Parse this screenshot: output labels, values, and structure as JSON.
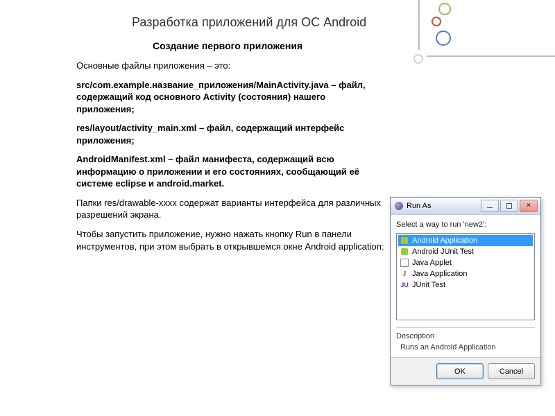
{
  "title": "Разработка приложений для ОС Android",
  "subtitle": "Создание первого приложения",
  "paragraphs": {
    "p1": "Основные файлы приложения – это:",
    "p2": "src/com.example.название_приложения/MainActivity.java – файл, содержащий код основного Activity (состояния) нашего приложения;",
    "p3": "res/layout/activity_main.xml – файл, содержащий интерфейс приложения;",
    "p4": "AndroidManifest.xml – файл манифеста, содержащий всю информацию о приложении и его состояниях, сообщающий её системе eclipse и android.market.",
    "p5": "Папки res/drawable-xxxx содержат варианты интерфейса для различных разрешений экрана.",
    "p6": "Чтобы запустить приложение, нужно нажать кнопку Run в панели инструментов, при этом выбрать в открывшемся окне Android application:"
  },
  "dialog": {
    "title": "Run As",
    "prompt": "Select a way to run 'new2':",
    "items": [
      {
        "label": "Android Application",
        "icon": "android",
        "selected": true
      },
      {
        "label": "Android JUnit Test",
        "icon": "android",
        "selected": false
      },
      {
        "label": "Java Applet",
        "icon": "applet",
        "selected": false
      },
      {
        "label": "Java Application",
        "icon": "java",
        "selected": false
      },
      {
        "label": "JUnit Test",
        "icon": "junit",
        "selected": false
      }
    ],
    "description_label": "Description",
    "description_text": "Runs an Android Application",
    "ok": "OK",
    "cancel": "Cancel"
  }
}
